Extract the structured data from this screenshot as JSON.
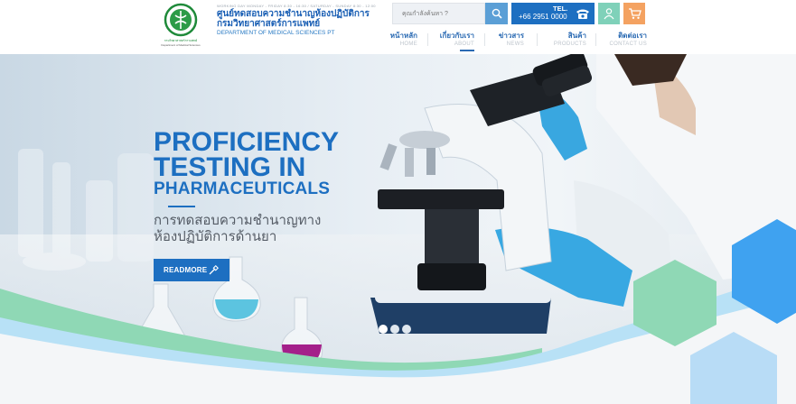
{
  "header": {
    "hours_text": "WORKING DAY MONDAY - FRIDAY 8:30 - 16:30 / SATURDAY - SUNDAY 8:30 - 12:00",
    "org_name_th_line1": "ศูนย์ทดสอบความชำนาญห้องปฏิบัติการ",
    "org_name_th_line2": "กรมวิทยาศาสตร์การแพทย์",
    "org_name_en": "DEPARTMENT OF MEDICAL SCIENCES PT",
    "logo_caption": "กรมวิทยาศาสตร์การแพทย์ Department of Medical Sciences"
  },
  "search": {
    "placeholder": "คุณกำลังค้นหา ?",
    "icon": "search-icon"
  },
  "contact": {
    "tel_label": "TEL.",
    "tel_number": "+66 2951 0000",
    "icons": [
      "phone-icon",
      "user-icon",
      "cart-icon"
    ]
  },
  "nav": [
    {
      "th": "หน้าหลัก",
      "en": "HOME",
      "active": false
    },
    {
      "th": "เกี่ยวกับเรา",
      "en": "ABOUT",
      "active": true
    },
    {
      "th": "ข่าวสาร",
      "en": "NEWS",
      "active": false
    },
    {
      "th": "สินค้า",
      "en": "PRODUCTS",
      "active": false
    },
    {
      "th": "ติดต่อเรา",
      "en": "CONTACT US",
      "active": false
    }
  ],
  "hero": {
    "title_line1": "PROFICIENCY",
    "title_line2": "TESTING IN",
    "title_line3": "PHARMACEUTICALS",
    "subtitle_line1": "การทดสอบความชำนาญทาง",
    "subtitle_line2": "ห้องปฏิบัติการด้านยา",
    "button_label": "READMORE",
    "slides": 3,
    "active_slide": 1
  },
  "colors": {
    "brand_blue": "#1d6fc1",
    "search_button": "#5b9fd6",
    "profile_button": "#7fd1b9",
    "cart_button": "#f4a261",
    "wave_green": "#8fd8b5",
    "hex_blue": "#3fa2f0"
  }
}
